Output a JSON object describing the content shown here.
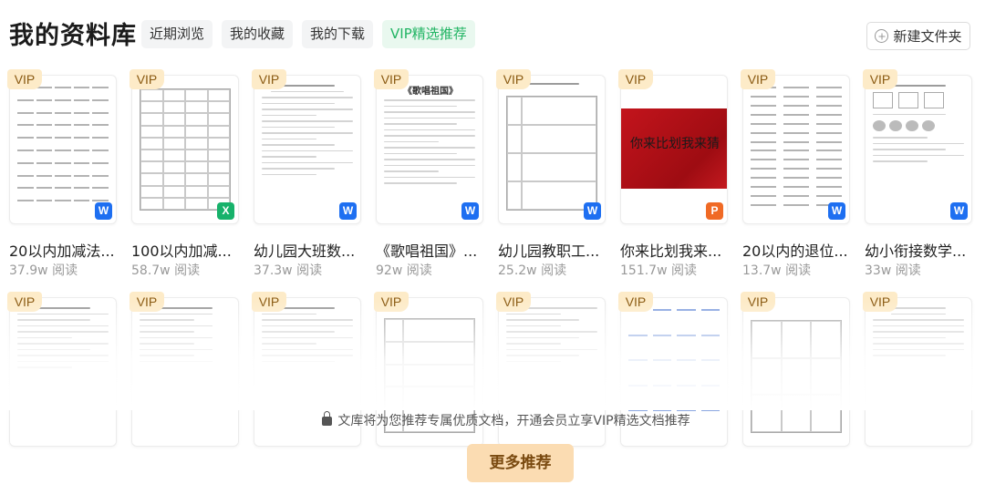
{
  "header": {
    "title": "我的资料库",
    "tabs": [
      {
        "label": "近期浏览",
        "active": false
      },
      {
        "label": "我的收藏",
        "active": false
      },
      {
        "label": "我的下载",
        "active": false
      },
      {
        "label": "VIP精选推荐",
        "active": true
      }
    ],
    "new_folder_label": "新建文件夹"
  },
  "colors": {
    "accent_green": "#21b463",
    "vip_badge_bg": "#fdebc8",
    "word_blue": "#1e6ff1",
    "excel_green": "#18b26b",
    "ppt_orange": "#f06a25",
    "more_button_bg": "#fbdcb2"
  },
  "row1": [
    {
      "vip": "VIP",
      "name": "20以内加减法...",
      "reads": "37.9w 阅读",
      "type": "word",
      "type_icon": "W"
    },
    {
      "vip": "VIP",
      "name": "100以内加减...",
      "reads": "58.7w 阅读",
      "type": "excel",
      "type_icon": "X"
    },
    {
      "vip": "VIP",
      "name": "幼儿园大班数...",
      "reads": "37.3w 阅读",
      "type": "word",
      "type_icon": "W"
    },
    {
      "vip": "VIP",
      "name": "《歌唱祖国》...",
      "reads": "92w 阅读",
      "type": "word",
      "type_icon": "W",
      "doc_heading": "《歌唱祖国》"
    },
    {
      "vip": "VIP",
      "name": "幼儿园教职工...",
      "reads": "25.2w 阅读",
      "type": "word",
      "type_icon": "W"
    },
    {
      "vip": "VIP",
      "name": "你来比划我来...",
      "reads": "151.7w 阅读",
      "type": "ppt",
      "type_icon": "P",
      "slide_text": "你来比划我来猜"
    },
    {
      "vip": "VIP",
      "name": "20以内的退位...",
      "reads": "13.7w 阅读",
      "type": "word",
      "type_icon": "W"
    },
    {
      "vip": "VIP",
      "name": "幼小衔接数学...",
      "reads": "33w 阅读",
      "type": "word",
      "type_icon": "W"
    }
  ],
  "row2": [
    {
      "vip": "VIP"
    },
    {
      "vip": "VIP"
    },
    {
      "vip": "VIP"
    },
    {
      "vip": "VIP"
    },
    {
      "vip": "VIP"
    },
    {
      "vip": "VIP"
    },
    {
      "vip": "VIP"
    },
    {
      "vip": "VIP"
    }
  ],
  "footer": {
    "notice": "文库将为您推荐专属优质文档，开通会员立享VIP精选文档推荐",
    "more_button": "更多推荐"
  }
}
